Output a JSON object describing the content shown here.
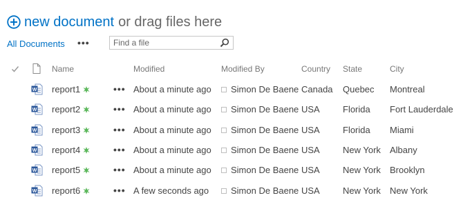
{
  "toolbar": {
    "new_document_label": "new document",
    "drag_hint": "or drag files here"
  },
  "views": {
    "current_view": "All Documents",
    "more_label": "•••"
  },
  "search": {
    "placeholder": "Find a file"
  },
  "columns": [
    "Name",
    "Modified",
    "Modified By",
    "Country",
    "State",
    "City"
  ],
  "rows": [
    {
      "name": "report1",
      "modified": "About a minute ago",
      "modified_by": "Simon De Baene",
      "country": "Canada",
      "state": "Quebec",
      "city": "Montreal"
    },
    {
      "name": "report2",
      "modified": "About a minute ago",
      "modified_by": "Simon De Baene",
      "country": "USA",
      "state": "Florida",
      "city": "Fort Lauderdale"
    },
    {
      "name": "report3",
      "modified": "About a minute ago",
      "modified_by": "Simon De Baene",
      "country": "USA",
      "state": "Florida",
      "city": "Miami"
    },
    {
      "name": "report4",
      "modified": "About a minute ago",
      "modified_by": "Simon De Baene",
      "country": "USA",
      "state": "New York",
      "city": "Albany"
    },
    {
      "name": "report5",
      "modified": "About a minute ago",
      "modified_by": "Simon De Baene",
      "country": "USA",
      "state": "New York",
      "city": "Brooklyn"
    },
    {
      "name": "report6",
      "modified": "A few seconds ago",
      "modified_by": "Simon De Baene",
      "country": "USA",
      "state": "New York",
      "city": "New York"
    }
  ],
  "row_menu_label": "•••",
  "colors": {
    "accent": "#0072c6",
    "new_badge": "#5cb85c",
    "word_icon": "#2b579a"
  },
  "icons": [
    "plus-circle-icon",
    "ellipsis-icon",
    "search-icon",
    "checkmark-icon",
    "file-icon",
    "word-document-icon",
    "new-item-icon",
    "presence-icon"
  ]
}
